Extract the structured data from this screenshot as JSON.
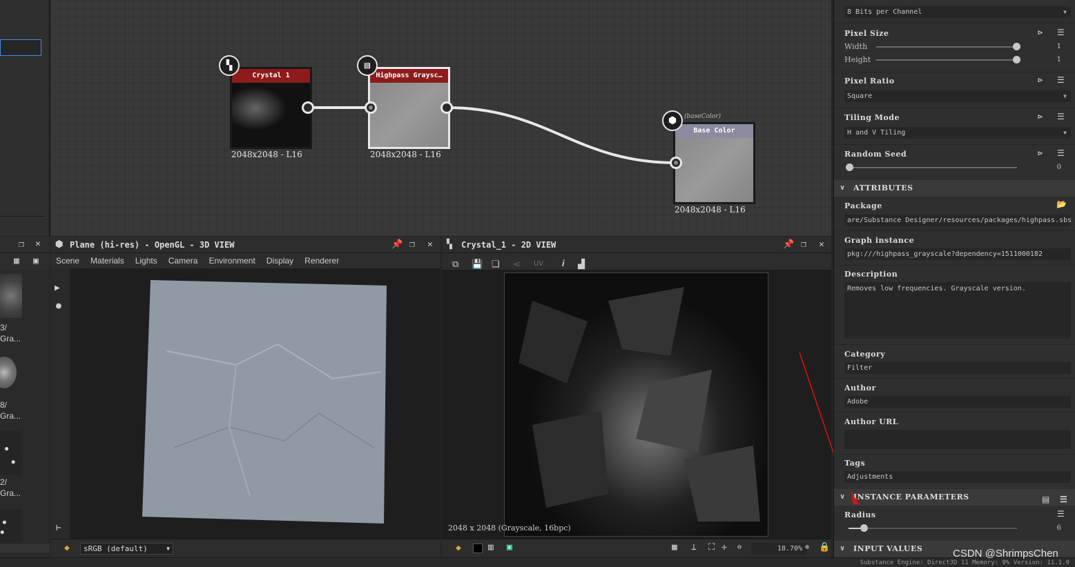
{
  "graph": {
    "nodes": [
      {
        "title": "Crystal 1",
        "size": "2048x2048 - L16",
        "header_color": "#8e1b1b"
      },
      {
        "title": "Highpass Graysc…",
        "size": "2048x2048 - L16",
        "header_color": "#8e1b1b"
      },
      {
        "title": "Base Color",
        "tag": "(baseColor)",
        "size": "2048x2048 - L16",
        "header_color": "#8a8aa0"
      }
    ]
  },
  "view3d": {
    "title": "Plane (hi-res) - OpenGL - 3D VIEW",
    "menu": [
      "Scene",
      "Materials",
      "Lights",
      "Camera",
      "Environment",
      "Display",
      "Renderer"
    ],
    "colorspace": "sRGB (default)"
  },
  "view2d": {
    "title": "Crystal_1 - 2D VIEW",
    "uv_label": "UV",
    "info": "2048 x 2048 (Grayscale, 16bpc)",
    "zoom": "18.70%"
  },
  "left": {
    "items": [
      {
        "line1": "3/",
        "line2": "Gra..."
      },
      {
        "line1": "8/",
        "line2": "Gra..."
      },
      {
        "line1": "2/",
        "line2": "Gra..."
      }
    ]
  },
  "props": {
    "format_value": "8 Bits per Channel",
    "pixel_size": "Pixel Size",
    "width_label": "Width",
    "width_value": "1",
    "height_label": "Height",
    "height_value": "1",
    "pixel_ratio": "Pixel Ratio",
    "pixel_ratio_value": "Square",
    "tiling_mode": "Tiling Mode",
    "tiling_value": "H and V Tiling",
    "random_seed": "Random Seed",
    "random_seed_value": "0",
    "attributes": "ATTRIBUTES",
    "package": "Package",
    "package_value": "are/Substance Designer/resources/packages/highpass.sbs",
    "graph_instance": "Graph instance",
    "graph_instance_value": "pkg:///highpass_grayscale?dependency=1511000182",
    "description": "Description",
    "description_value": "Removes low frequencies. Grayscale version.",
    "category": "Category",
    "category_value": "Filter",
    "author": "Author",
    "author_value": "Adobe",
    "author_url": "Author URL",
    "tags": "Tags",
    "tags_value": "Adjustments",
    "instance_params": "INSTANCE PARAMETERS",
    "radius": "Radius",
    "radius_value": "6",
    "input_values": "INPUT VALUES"
  },
  "status": "Substance Engine: Direct3D 11  Memory: 0%    Version: 11.1.0",
  "watermark": "CSDN @ShrimpsChen",
  "accent": "#3d8ee8"
}
